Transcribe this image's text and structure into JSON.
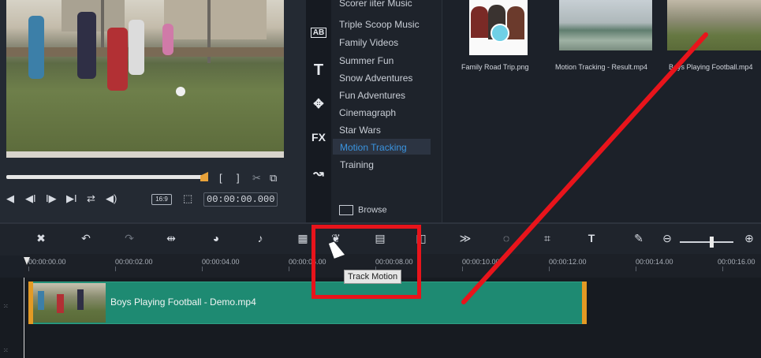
{
  "preview": {
    "aspect": "16:9",
    "timecode": "00:00:00.000",
    "controls": [
      "◀",
      "◀I",
      "I▶",
      "▶I",
      "⇄",
      "◀)"
    ]
  },
  "categories": {
    "items": [
      "Scorer iiter Music",
      "Triple Scoop Music",
      "Family Videos",
      "Summer Fun",
      "Snow Adventures",
      "Fun Adventures",
      "Cinemagraph",
      "Star Wars",
      "Motion Tracking",
      "Training"
    ],
    "selected": "Motion Tracking",
    "browse_label": "Browse"
  },
  "strip_icons": [
    "AB",
    "T",
    "FX"
  ],
  "library": {
    "items": [
      {
        "label": "Family Road Trip.png"
      },
      {
        "label": "Motion Tracking - Result.mp4"
      },
      {
        "label": "Boys Playing Football.mp4"
      }
    ]
  },
  "timeline": {
    "ticks": [
      "00:00:00.00",
      "00:00:02.00",
      "00:00:04.00",
      "00:00:06.00",
      "00:00:08.00",
      "00:00:10.00",
      "00:00:12.00",
      "00:00:14.00",
      "00:00:16.00"
    ],
    "clip_label": "Boys Playing Football - Demo.mp4"
  },
  "tooltip": "Track Motion",
  "colors": {
    "accent_selected": "#2d8cd9",
    "clip_green": "#1e8a72",
    "annotation_red": "#e8141b",
    "handle_orange": "#e39a24"
  }
}
